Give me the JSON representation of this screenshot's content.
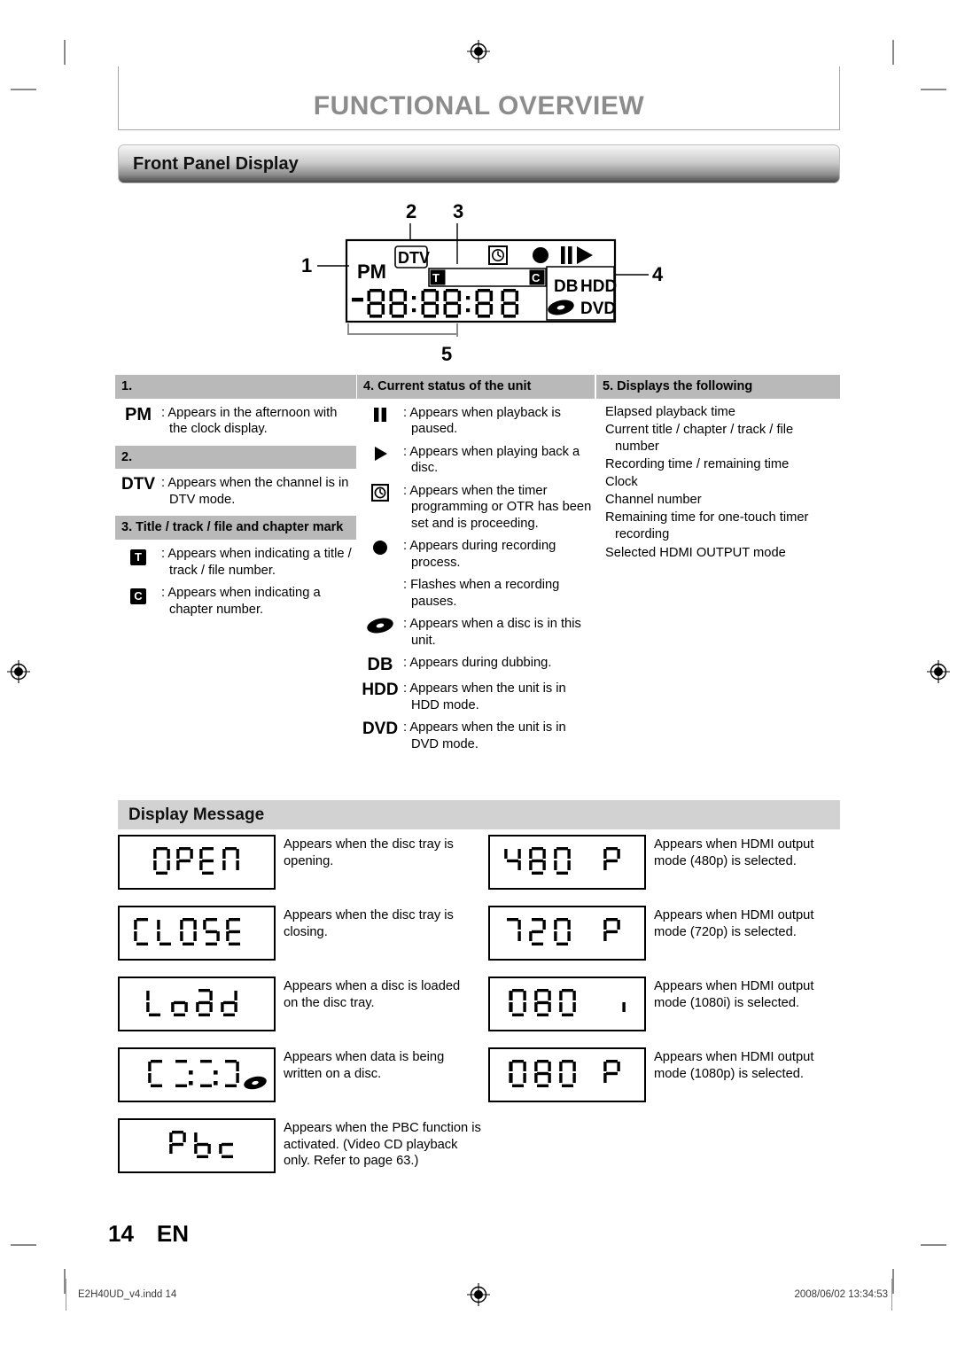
{
  "document": {
    "chapter_title": "FUNCTIONAL OVERVIEW",
    "page_number": "14",
    "language_code": "EN",
    "footer_left": "E2H40UD_v4.indd   14",
    "footer_right": "2008/06/02   13:34:53"
  },
  "sections": {
    "front_panel_display": "Front Panel Display",
    "display_message": "Display Message"
  },
  "diagram": {
    "callouts": [
      "1",
      "2",
      "3",
      "4",
      "5"
    ],
    "indicators": {
      "pm": "PM",
      "dtv": "DTV",
      "title_mark": "T",
      "chapter_mark": "C",
      "db": "DB",
      "hdd": "HDD",
      "dvd": "DVD"
    },
    "segment_readout": "-00:00:00"
  },
  "legend": {
    "col1": {
      "groups": [
        {
          "header": "1.",
          "items": [
            {
              "glyph": "PM",
              "glyph_type": "text",
              "lines": [
                ": Appears in the afternoon with the clock display."
              ]
            }
          ]
        },
        {
          "header": "2.",
          "items": [
            {
              "glyph": "DTV",
              "glyph_type": "text",
              "lines": [
                ": Appears when the channel is in DTV mode."
              ]
            }
          ]
        },
        {
          "header": "3. Title / track / file and chapter mark",
          "items": [
            {
              "glyph": "T",
              "glyph_type": "inverted-box",
              "lines": [
                ": Appears when indicating a title / track / file number."
              ]
            },
            {
              "glyph": "C",
              "glyph_type": "inverted-box",
              "lines": [
                ": Appears when indicating a chapter number."
              ]
            }
          ]
        }
      ]
    },
    "col2": {
      "header": "4. Current status of the unit",
      "items": [
        {
          "glyph": "pause-icon",
          "glyph_type": "icon",
          "lines": [
            ": Appears when playback is paused."
          ]
        },
        {
          "glyph": "play-icon",
          "glyph_type": "icon",
          "lines": [
            ": Appears when playing back a disc."
          ]
        },
        {
          "glyph": "timer-clock-icon",
          "glyph_type": "icon",
          "lines": [
            ": Appears when the timer programming or OTR has been set and is proceeding."
          ]
        },
        {
          "glyph": "record-dot-icon",
          "glyph_type": "icon",
          "lines": [
            ": Appears during recording process.",
            ": Flashes when a recording pauses."
          ]
        },
        {
          "glyph": "disc-icon",
          "glyph_type": "icon",
          "lines": [
            ": Appears when a disc is in this unit."
          ]
        },
        {
          "glyph": "DB",
          "glyph_type": "text",
          "lines": [
            ": Appears during dubbing."
          ]
        },
        {
          "glyph": "HDD",
          "glyph_type": "text",
          "lines": [
            ": Appears when the unit is in HDD mode."
          ]
        },
        {
          "glyph": "DVD",
          "glyph_type": "text",
          "lines": [
            ": Appears when the unit is in DVD mode."
          ]
        }
      ]
    },
    "col3": {
      "header": "5. Displays the following",
      "bullets": [
        "Elapsed playback time",
        "Current title / chapter / track / file number",
        "Recording time / remaining time",
        "Clock",
        "Channel number",
        "Remaining time for one-touch timer recording",
        "Selected HDMI OUTPUT mode"
      ]
    }
  },
  "display_messages": {
    "left": [
      {
        "segments": "OPEN",
        "text": "Appears when the disc tray is opening."
      },
      {
        "segments": "CLOSE",
        "text": "Appears when the disc tray is closing."
      },
      {
        "segments": "Load",
        "text": "Appears when a disc is loaded on the disc tray."
      },
      {
        "segments": "[::]",
        "text": "Appears when data is being written on a disc."
      },
      {
        "segments": "Pbc",
        "text": "Appears when the PBC function is activated. (Video CD playback only. Refer to page 63.)"
      }
    ],
    "right": [
      {
        "segments": "480 P",
        "text": "Appears when HDMI output mode (480p) is selected."
      },
      {
        "segments": "720 P",
        "text": "Appears when HDMI output mode (720p) is selected."
      },
      {
        "segments": "1080 i",
        "text": "Appears when HDMI output mode (1080i) is selected."
      },
      {
        "segments": "1080 P",
        "text": "Appears when HDMI output mode (1080p) is selected."
      }
    ]
  },
  "colors": {
    "title_gray": "#8c8c8c",
    "header_gray": "#b9b9b9",
    "bar_gray": "#d2d2d2",
    "crop_mark": "#8a8a8a"
  }
}
